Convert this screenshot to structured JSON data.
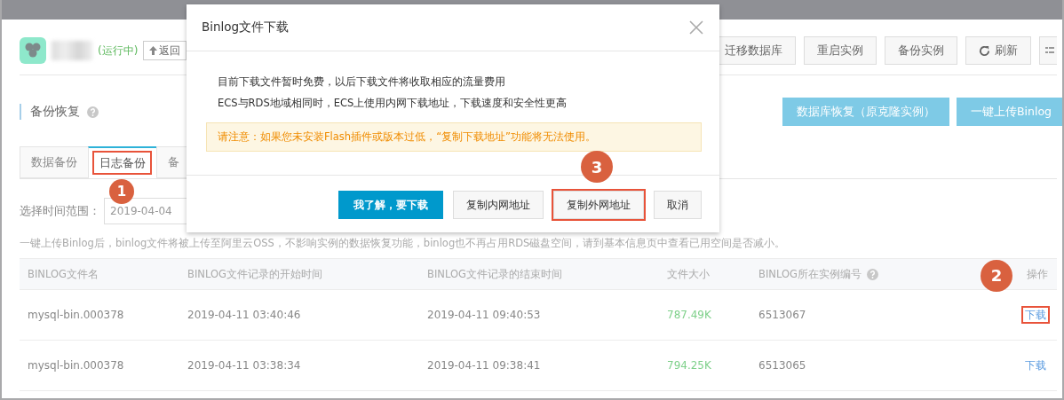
{
  "header": {
    "status": "(运行中)",
    "back_button": "返回",
    "actions": [
      {
        "label": "迁移数据库",
        "kind": "plain"
      },
      {
        "label": "重启实例",
        "kind": "plain"
      },
      {
        "label": "备份实例",
        "kind": "plain"
      },
      {
        "label": "刷新",
        "kind": "refresh"
      }
    ]
  },
  "section": {
    "title": "备份恢复",
    "actions": [
      "数据库恢复（原克隆实例）",
      "一键上传Binlog"
    ]
  },
  "tabs": [
    {
      "label": "数据备份",
      "selected": false,
      "highlighted": false
    },
    {
      "label": "日志备份",
      "selected": true,
      "highlighted": true,
      "badge": "1"
    },
    {
      "label": "备",
      "selected": false,
      "highlighted": false
    }
  ],
  "filter": {
    "label": "选择时间范围：",
    "value": "2019-04-04"
  },
  "notice": "一键上传Binlog后，binlog文件将被上传至阿里云OSS，不影响实例的数据恢复功能，binlog也不再占用RDS磁盘空间，请到基本信息页中查看已用空间是否减小。",
  "table": {
    "columns": [
      "BINLOG文件名",
      "BINLOG文件记录的开始时间",
      "BINLOG文件记录的结束时间",
      "文件大小",
      "BINLOG所在实例编号",
      "操作"
    ],
    "rows": [
      {
        "file": "mysql-bin.000378",
        "start": "2019-04-11 03:40:46",
        "end": "2019-04-11 09:40:53",
        "size": "787.49K",
        "instance": "6513067",
        "action": "下载",
        "highlighted": true,
        "badge": "2"
      },
      {
        "file": "mysql-bin.000378",
        "start": "2019-04-11 03:38:34",
        "end": "2019-04-11 09:38:41",
        "size": "794.25K",
        "instance": "6513065",
        "action": "下载",
        "highlighted": false
      }
    ]
  },
  "dialog": {
    "title": "Binlog文件下载",
    "lines": [
      "目前下载文件暂时免费，以后下载文件将收取相应的流量费用",
      "ECS与RDS地域相同时，ECS上使用内网下载地址，下载速度和安全性更高"
    ],
    "warning": "请注意：如果您未安装Flash插件或版本过低，“复制下载地址”功能将无法使用。",
    "buttons": [
      {
        "label": "我了解，要下载",
        "kind": "primary",
        "highlighted": false
      },
      {
        "label": "复制内网地址",
        "kind": "secondary",
        "highlighted": false
      },
      {
        "label": "复制外网地址",
        "kind": "secondary",
        "highlighted": true,
        "badge": "3"
      },
      {
        "label": "取消",
        "kind": "secondary",
        "highlighted": false
      }
    ]
  }
}
